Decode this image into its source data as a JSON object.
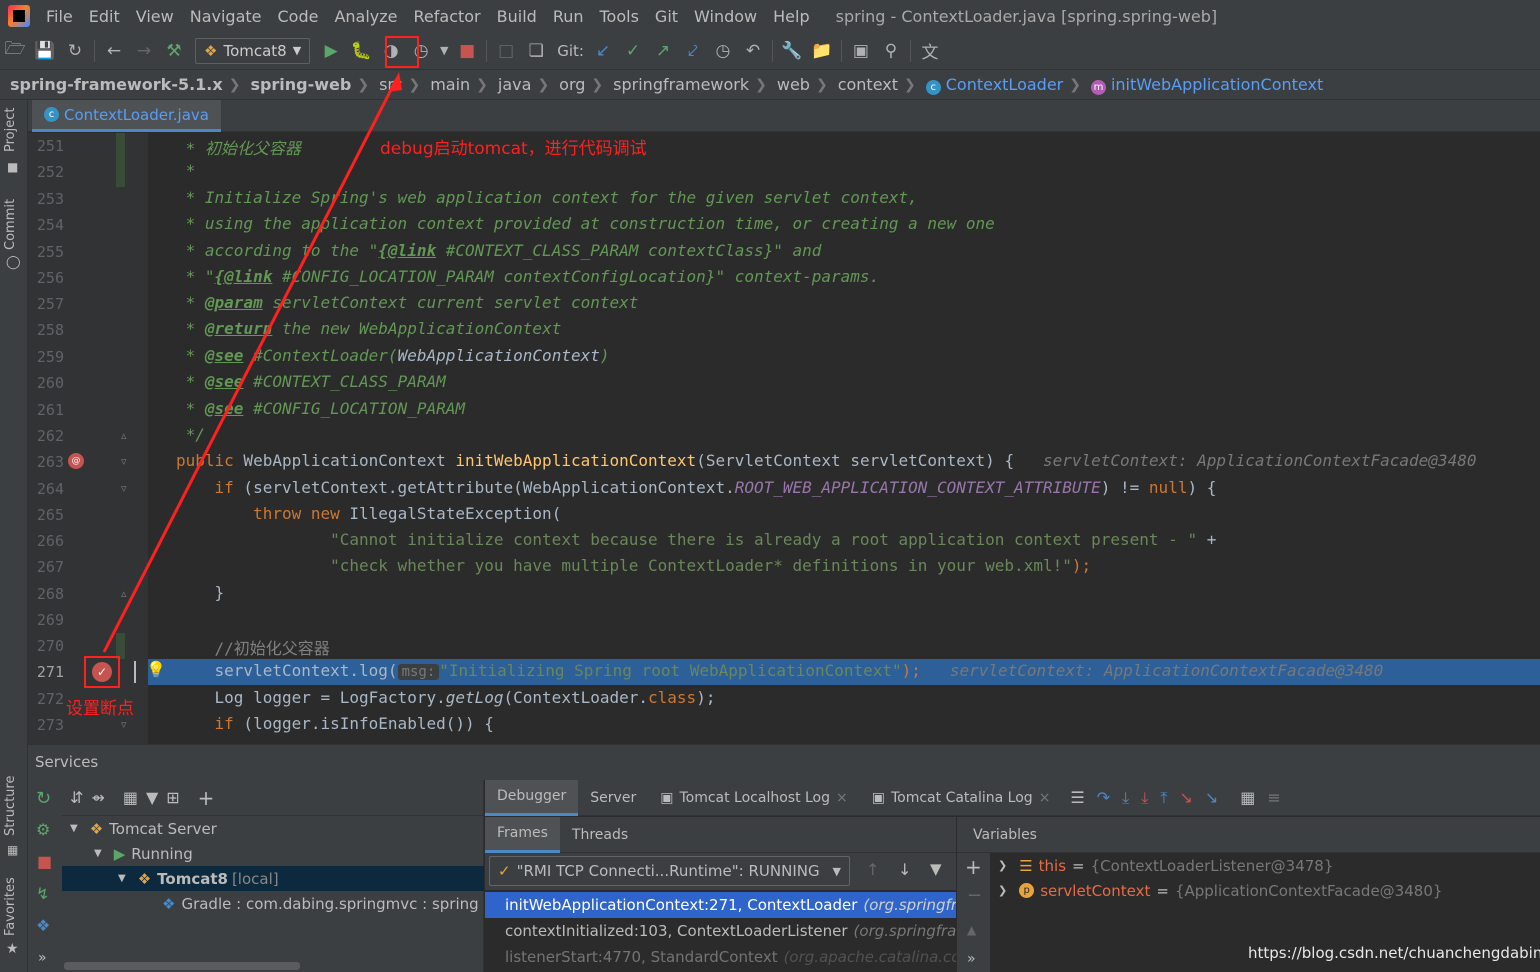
{
  "menubar": {
    "items": [
      "File",
      "Edit",
      "View",
      "Navigate",
      "Code",
      "Analyze",
      "Refactor",
      "Build",
      "Run",
      "Tools",
      "Git",
      "Window",
      "Help"
    ],
    "mnemonics": [
      "F",
      "E",
      "V",
      "N",
      "C",
      "z",
      "R",
      "B",
      "u",
      "T",
      "G",
      "W",
      "H"
    ],
    "window_title": "spring - ContextLoader.java [spring.spring-web]"
  },
  "toolbar": {
    "run_config": "Tomcat8",
    "git_label": "Git:"
  },
  "breadcrumbs": [
    "spring-framework-5.1.x",
    "spring-web",
    "src",
    "main",
    "java",
    "org",
    "springframework",
    "web",
    "context",
    "ContextLoader",
    "initWebApplicationContext"
  ],
  "file_tab": "ContextLoader.java",
  "left_strip": {
    "project": "Project",
    "commit": "Commit",
    "structure": "Structure",
    "favorites": "Favorites"
  },
  "code": {
    "line_numbers": [
      "251",
      "252",
      "253",
      "254",
      "255",
      "256",
      "257",
      "258",
      "259",
      "260",
      "261",
      "262",
      "263",
      "264",
      "265",
      "266",
      "267",
      "268",
      "269",
      "270",
      "271",
      "272",
      "273"
    ],
    "l251": " * 初始化父容器",
    "l252": " *",
    "l253": " * Initialize Spring's web application context for the given servlet context,",
    "l254": " * using the application context provided at construction time, or creating a new one",
    "l255a": " * according to the \"",
    "l255b": "{@link",
    "l255c": " #CONTEXT_CLASS_PARAM contextClass}\" and",
    "l256a": " * \"",
    "l256b": "{@link",
    "l256c": " #CONFIG_LOCATION_PARAM contextConfigLocation}\" context-params.",
    "l257a": " * ",
    "l257b": "@param",
    "l257c": " servletContext current servlet context",
    "l258a": " * ",
    "l258b": "@return",
    "l258c": " the new WebApplicationContext",
    "l259a": " * ",
    "l259b": "@see",
    "l259c": " #ContextLoader(",
    "l259d": "WebApplicationContext",
    "l259e": ")",
    "l260a": " * ",
    "l260b": "@see",
    "l260c": " #CONTEXT_CLASS_PARAM",
    "l261a": " * ",
    "l261b": "@see",
    "l261c": " #CONFIG_LOCATION_PARAM",
    "l262": " */",
    "l263a": "public",
    "l263b": " WebApplicationContext ",
    "l263c": "initWebApplicationContext",
    "l263d": "(ServletContext servletContext) {",
    "l263hint": "servletContext: ApplicationContextFacade@3480",
    "l264a": "    if",
    "l264b": " (servletContext.getAttribute(WebApplicationContext.",
    "l264c": "ROOT_WEB_APPLICATION_CONTEXT_ATTRIBUTE",
    "l264d": ") != ",
    "l264e": "null",
    "l264f": ") {",
    "l265a": "        throw new",
    "l265b": " IllegalStateException(",
    "l266a": "                \"Cannot initialize context because there is already a root application context present - \"",
    "l266b": " +",
    "l267a": "                \"check whether you have multiple ContextLoader* definitions in your web.xml!\"",
    "l267b": ");",
    "l268": "    }",
    "l269": "",
    "l270": "    //初始化父容器",
    "l271a": "    servletContext.log(",
    "l271msg": "msg:",
    "l271b": "\"Initializing Spring root WebApplicationContext\"",
    "l271c": ");",
    "l271hint": "servletContext: ApplicationContextFacade@3480",
    "l272a": "    Log logger = LogFactory.",
    "l272b": "getLog",
    "l272c": "(ContextLoader.",
    "l272d": "class",
    "l272e": ");",
    "l273a": "    if",
    "l273b": " (logger.isInfoEnabled()) {"
  },
  "annotations": {
    "debug_note": "debug启动tomcat，进行代码调试",
    "breakpoint_note": "设置断点"
  },
  "services": {
    "title": "Services",
    "tree": {
      "server": "Tomcat Server",
      "running": "Running",
      "tomcat": "Tomcat8",
      "tomcat_suffix": "[local]",
      "gradle": "Gradle : com.dabing.springmvc : spring"
    }
  },
  "debugger": {
    "tabs": [
      "Debugger",
      "Server",
      "Tomcat Localhost Log",
      "Tomcat Catalina Log"
    ],
    "frames_tab": "Frames",
    "threads_tab": "Threads",
    "variables_tab": "Variables",
    "thread": "\"RMI TCP Connecti...Runtime\": RUNNING",
    "frames": [
      {
        "method": "initWebApplicationContext:271, ContextLoader",
        "pkg": "(org.springframework.web.context)"
      },
      {
        "method": "contextInitialized:103, ContextLoaderListener",
        "pkg": "(org.springframework.web.context)"
      },
      {
        "method": "listenerStart:4770, StandardContext",
        "pkg": "(org.apache.catalina.core)"
      }
    ],
    "variables": [
      {
        "name": "this",
        "value": "{ContextLoaderListener@3478}"
      },
      {
        "name": "servletContext",
        "value": "{ApplicationContextFacade@3480}"
      }
    ]
  },
  "watermark": "https://blog.csdn.net/chuanchengdabing",
  "colors": {
    "accent": "#2d6099",
    "annotation": "#ff2020",
    "link": "#589df6"
  }
}
